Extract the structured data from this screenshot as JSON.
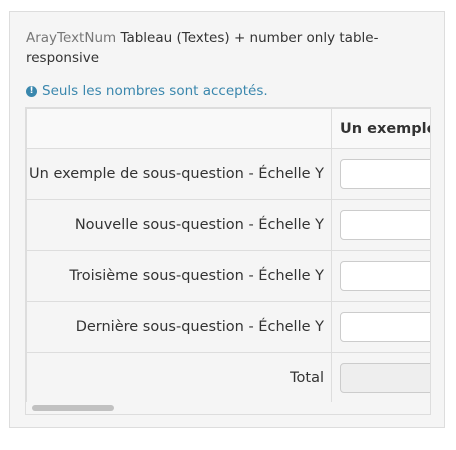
{
  "question": {
    "code": "ArayTextNum",
    "title": "Tableau (Textes) + number only table-responsive"
  },
  "tip": {
    "icon": "exclamation-circle-icon",
    "text": "Seuls les nombres sont acceptés."
  },
  "table": {
    "column_header": "Un exemple",
    "rows": [
      {
        "label": "Un exemple de sous-question - Échelle Y",
        "value": ""
      },
      {
        "label": "Nouvelle sous-question - Échelle Y",
        "value": ""
      },
      {
        "label": "Troisième sous-question - Échelle Y",
        "value": ""
      },
      {
        "label": "Dernière sous-question - Échelle Y",
        "value": ""
      }
    ],
    "total_label": "Total",
    "total_value": ""
  },
  "colors": {
    "tip": "#3a87ad",
    "panel_background": "#f5f5f5",
    "border": "#dddddd"
  }
}
